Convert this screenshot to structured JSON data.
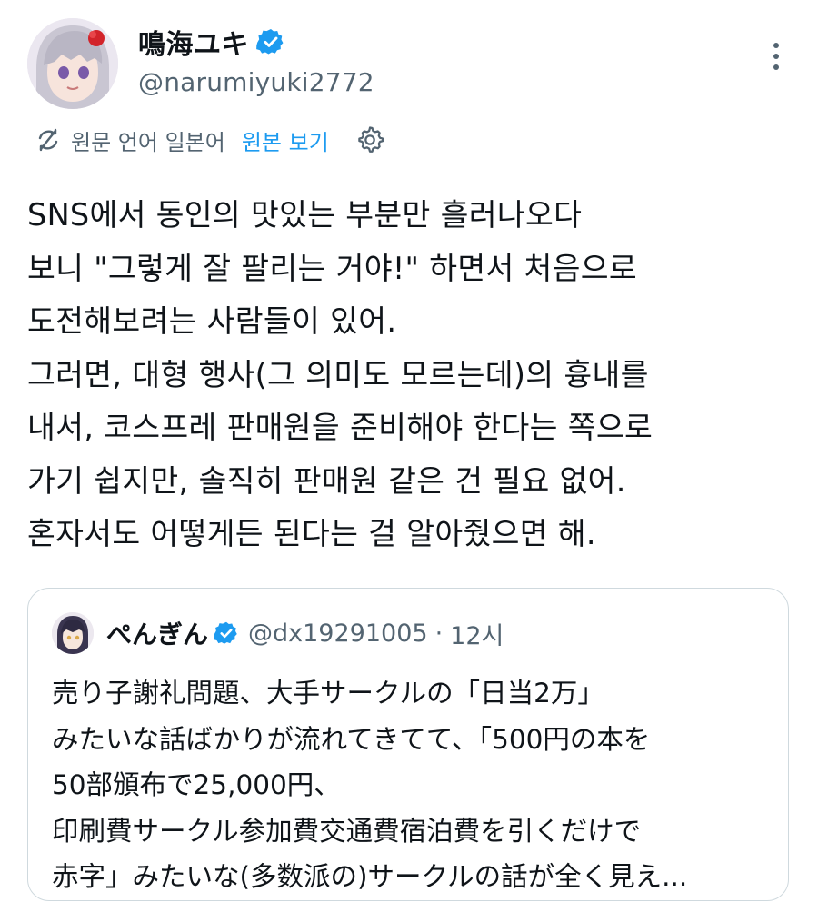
{
  "author": {
    "display_name": "鳴海ユキ",
    "handle": "@narumiyuki2772",
    "verified_icon": "verified-badge-icon",
    "more_icon": "more-vertical-icon"
  },
  "translation": {
    "source_language_text": "원문 언어 일본어",
    "show_original_label": "원본 보기",
    "translate_icon": "translate-off-icon",
    "settings_icon": "gear-icon"
  },
  "post": {
    "lines": [
      "SNS에서 동인의 맛있는 부분만 흘러나오다",
      "보니 \"그렇게 잘 팔리는 거야!\" 하면서 처음으로",
      "도전해보려는 사람들이 있어.",
      "그러면, 대형 행사(그 의미도 모르는데)의 흉내를",
      "내서, 코스프레 판매원을 준비해야 한다는 쪽으로",
      "가기 쉽지만, 솔직히 판매원 같은 건 필요 없어.",
      "혼자서도 어떻게든 된다는 걸 알아줬으면 해."
    ]
  },
  "quoted_post": {
    "display_name": "ぺんぎん",
    "handle": "@dx19291005",
    "separator": "·",
    "time": "12시",
    "lines": [
      "売り子謝礼問題、大手サークルの「日当2万」",
      "みたいな話ばかりが流れてきてて、「500円の本を",
      "50部頒布で25,000円、",
      "印刷費サークル参加費交通費宿泊費を引くだけで",
      "赤字」みたいな(多数派の)サークルの話が全く見え..."
    ]
  },
  "colors": {
    "text": "#0f1419",
    "secondary": "#536471",
    "accent": "#1d9bf0",
    "border": "#cfd9de"
  }
}
